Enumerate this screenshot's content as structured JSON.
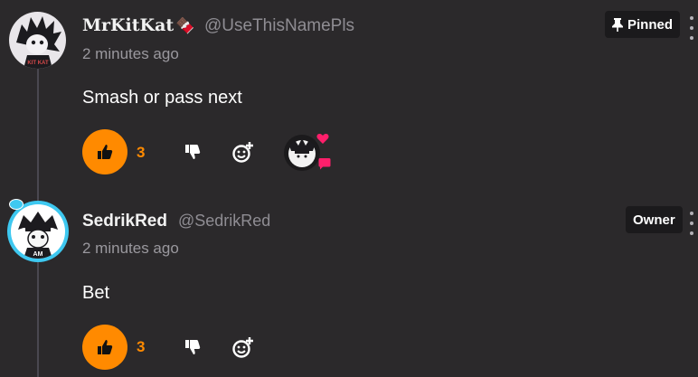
{
  "colors": {
    "background": "#2b292b",
    "accent": "#ff8a00",
    "badge_bg": "#1b1a1c",
    "heart": "#ff1f6b",
    "muted": "#8f8d93"
  },
  "comments": [
    {
      "username": "MrKitKat",
      "username_emoji": "🍫",
      "handle": "@UseThisNamePls",
      "timestamp": "2 minutes ago",
      "text": "Smash or pass next",
      "badge": {
        "label": "Pinned",
        "icon": "pin-icon"
      },
      "likes": "3",
      "creator_reaction": {
        "icons": [
          "heart-icon",
          "chat-bubble-icon"
        ]
      },
      "avatar_text": "KIT KAT"
    },
    {
      "username": "SedrikRed",
      "handle": "@SedrikRed",
      "timestamp": "2 minutes ago",
      "text": "Bet",
      "badge": {
        "label": "Owner"
      },
      "likes": "3",
      "avatar_text": "AM"
    }
  ]
}
